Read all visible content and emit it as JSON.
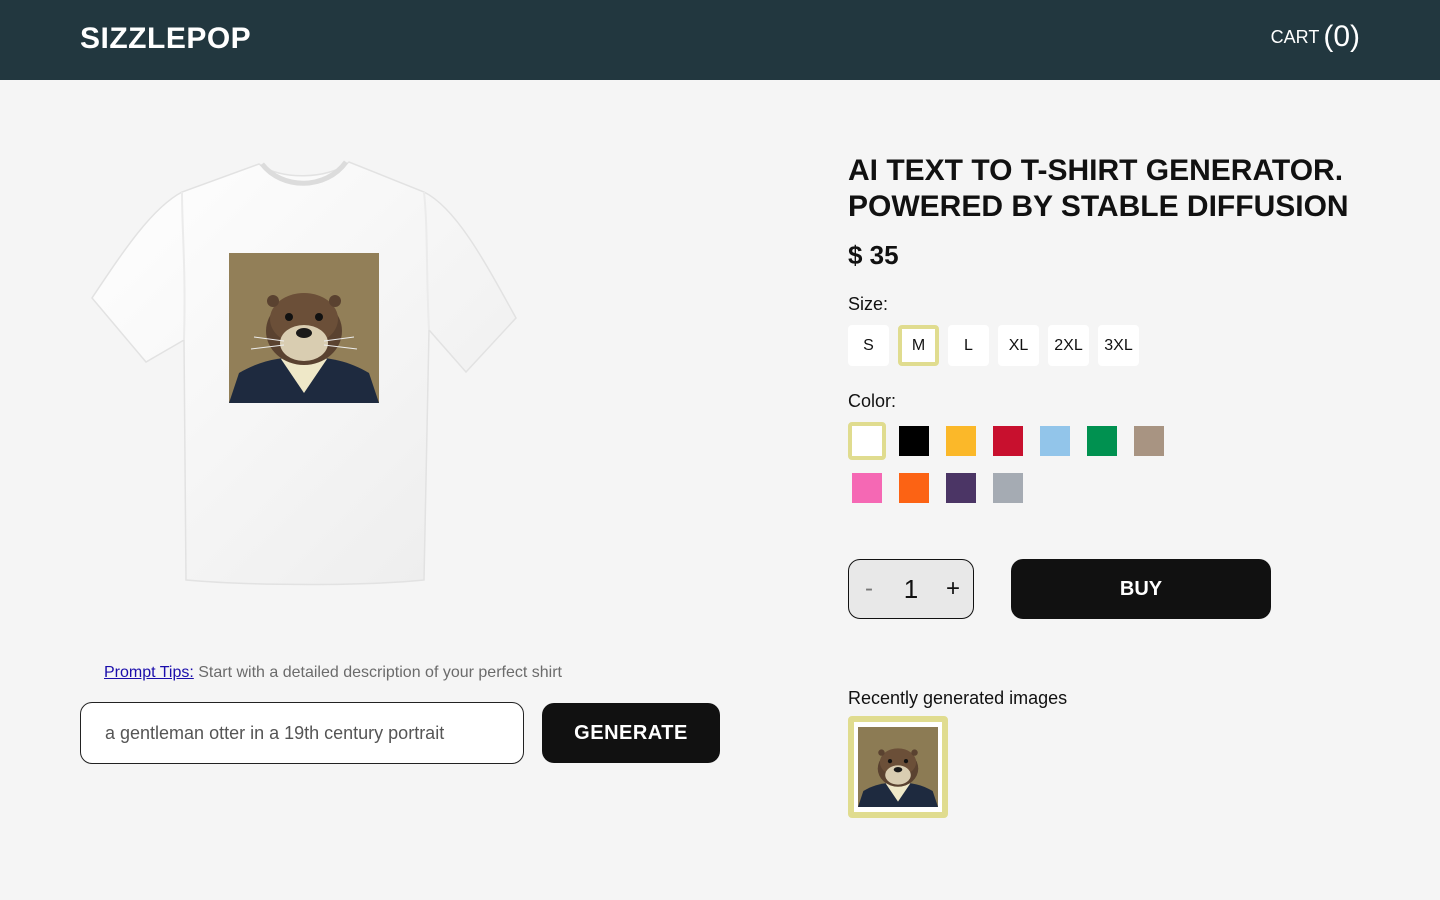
{
  "header": {
    "logo": "SIZZLEPOP",
    "cart_label": "CART",
    "cart_count": "(0)"
  },
  "product": {
    "title_line1": "AI TEXT TO T-SHIRT GENERATOR.",
    "title_line2": "POWERED BY STABLE DIFFUSION",
    "price": "$ 35"
  },
  "size": {
    "label": "Size:",
    "options": [
      "S",
      "M",
      "L",
      "XL",
      "2XL",
      "3XL"
    ],
    "selected": "M"
  },
  "color": {
    "label": "Color:",
    "swatches": [
      "#ffffff",
      "#000000",
      "#fbb829",
      "#c8102e",
      "#92c5ea",
      "#009150",
      "#a89482",
      "#f568b4",
      "#fc6314",
      "#4b3565",
      "#a5abb3"
    ],
    "selected": "#ffffff"
  },
  "quantity": {
    "minus": "-",
    "value": "1",
    "plus": "+"
  },
  "buy_label": "BUY",
  "prompt": {
    "tips_link": "Prompt Tips:",
    "tips_text": " Start with a detailed description of your perfect shirt",
    "value": "a gentleman otter in a 19th century portrait",
    "generate_label": "GENERATE"
  },
  "recent": {
    "label": "Recently generated images"
  },
  "colors": {
    "header_bg": "#22373f",
    "selected_outline": "#e0dc8f"
  },
  "icons": {
    "shirt": "tshirt-image",
    "artwork": "otter-portrait-image"
  }
}
